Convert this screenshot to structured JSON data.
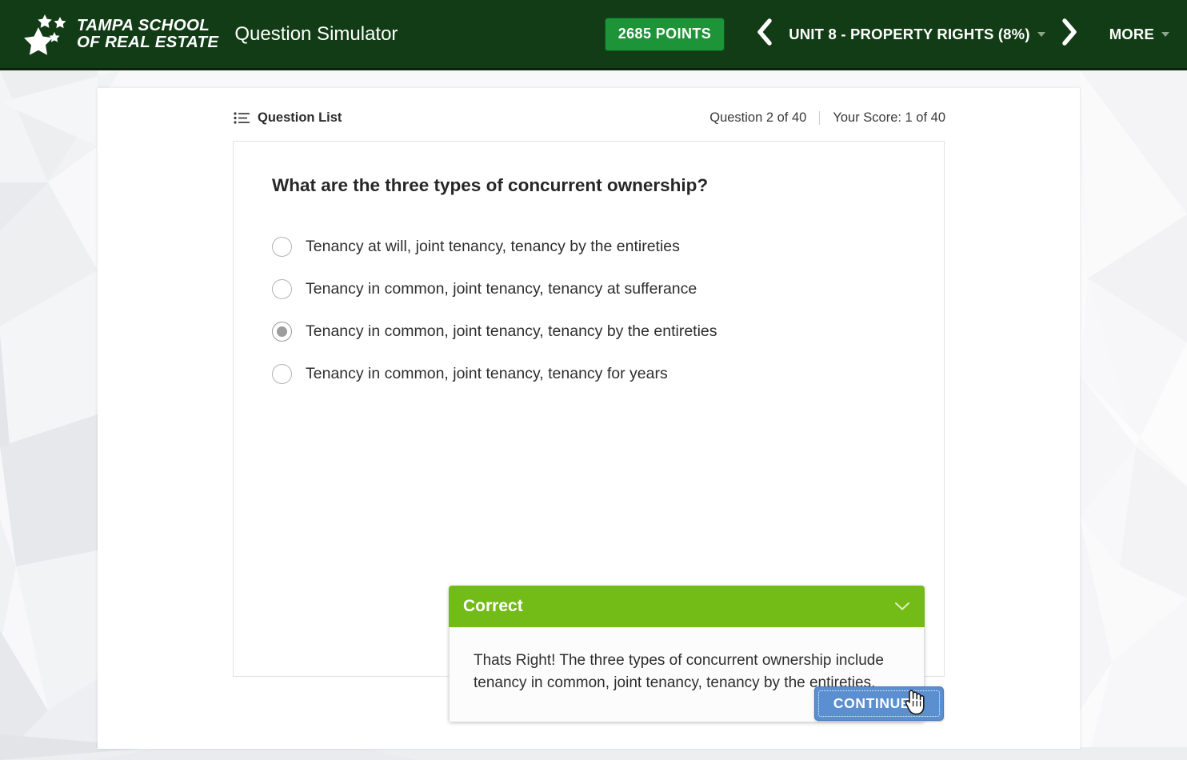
{
  "header": {
    "logo": {
      "line1": "TAMPA SCHOOL",
      "line2": "OF REAL ESTATE",
      "star_icon": "star-icon"
    },
    "app_title": "Question Simulator",
    "points_label": "2685 POINTS",
    "prev_arrow": "‹",
    "next_arrow": "›",
    "unit_label": "UNIT 8 - PROPERTY RIGHTS (8%)",
    "more_label": "MORE",
    "bar_color": "#123c15",
    "points_color": "#1d9437"
  },
  "meta": {
    "question_list_label": "Question List",
    "question_counter": "Question 2 of 40",
    "score_text": "Your Score: 1 of 40"
  },
  "question": {
    "text": "What are the three types of concurrent ownership?",
    "options": [
      {
        "label": "Tenancy at will, joint tenancy, tenancy by the entireties",
        "selected": false
      },
      {
        "label": "Tenancy in common, joint tenancy, tenancy at sufferance",
        "selected": false
      },
      {
        "label": "Tenancy in common, joint tenancy, tenancy by the entireties",
        "selected": true
      },
      {
        "label": "Tenancy in common, joint tenancy, tenancy for years",
        "selected": false
      }
    ]
  },
  "feedback": {
    "title": "Correct",
    "body": "Thats Right! The three types of concurrent ownership include tenancy in common, joint tenancy, tenancy by the entireties.",
    "header_color": "#73bc18",
    "toggle_icon": "chevron-down-icon"
  },
  "footer": {
    "continue_label": "CONTINUE",
    "continue_color": "#5b8fd0",
    "continue_icon": "chevron-right-icon"
  },
  "cursor": {
    "icon": "pointing-hand-cursor"
  }
}
